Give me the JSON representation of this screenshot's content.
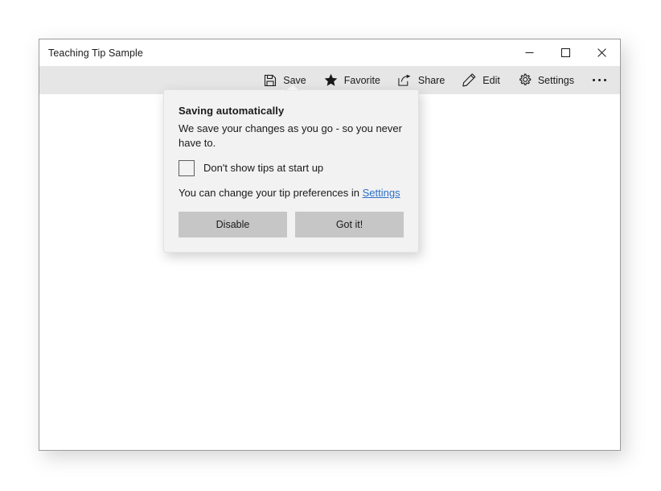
{
  "window": {
    "title": "Teaching Tip Sample",
    "controls": [
      {
        "name": "minimize",
        "label": "—"
      },
      {
        "name": "maximize",
        "label": "□"
      },
      {
        "name": "close",
        "label": "✕"
      }
    ]
  },
  "command_bar": {
    "items": [
      {
        "icon": "save-icon",
        "label": "Save"
      },
      {
        "icon": "favorite-star-icon",
        "label": "Favorite"
      },
      {
        "icon": "share-icon",
        "label": "Share"
      },
      {
        "icon": "edit-pencil-icon",
        "label": "Edit"
      },
      {
        "icon": "settings-gear-icon",
        "label": "Settings"
      }
    ],
    "more_label": "See more"
  },
  "teaching_tip": {
    "title": "Saving automatically",
    "subtitle": "We save your changes as you go - so you never have to.",
    "checkbox": {
      "label": "Don't show tips at start up",
      "checked": false
    },
    "preference_text_prefix": "You can change your tip preferences in ",
    "preference_link": "Settings",
    "buttons": {
      "secondary": "Disable",
      "primary": "Got it!"
    }
  },
  "colors": {
    "title_bar": "#ffffff",
    "command_bar": "#e6e6e6",
    "content": "#ffffff",
    "tip_background": "#f2f2f2",
    "tip_button": "#c6c6c6",
    "link": "#2a6fc9",
    "text": "#1a1a1a",
    "window_border": "#9b9b9b"
  }
}
